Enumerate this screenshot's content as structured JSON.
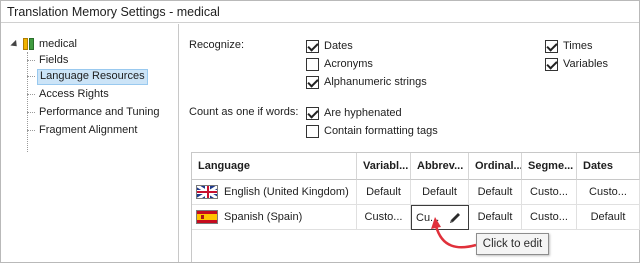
{
  "window": {
    "title": "Translation Memory Settings - medical"
  },
  "tree": {
    "root": "medical",
    "items": [
      {
        "label": "Fields",
        "selected": false
      },
      {
        "label": "Language Resources",
        "selected": true
      },
      {
        "label": "Access Rights",
        "selected": false
      },
      {
        "label": "Performance and Tuning",
        "selected": false
      },
      {
        "label": "Fragment Alignment",
        "selected": false
      }
    ]
  },
  "recognize": {
    "label": "Recognize:",
    "options": [
      {
        "label": "Dates",
        "checked": true
      },
      {
        "label": "Acronyms",
        "checked": false
      },
      {
        "label": "Alphanumeric strings",
        "checked": true
      },
      {
        "label": "Times",
        "checked": true
      },
      {
        "label": "Variables",
        "checked": true
      }
    ]
  },
  "count": {
    "label": "Count as one if words:",
    "options": [
      {
        "label": "Are hyphenated",
        "checked": true
      },
      {
        "label": "Contain formatting tags",
        "checked": false
      }
    ]
  },
  "grid": {
    "headers": [
      "Language",
      "Variabl...",
      "Abbrev...",
      "Ordinal...",
      "Segme...",
      "Dates"
    ],
    "rows": [
      {
        "language": "English (United Kingdom)",
        "flag": "uk-flag",
        "cells": [
          "Default",
          "Default",
          "Default",
          "Custo...",
          "Custo..."
        ]
      },
      {
        "language": "Spanish (Spain)",
        "flag": "spain-flag",
        "cells": [
          "Custo...",
          "Cu...",
          "Default",
          "Custo...",
          "Default"
        ]
      }
    ]
  },
  "tooltip": {
    "text": "Click to edit"
  },
  "colors": {
    "selection": "#cce4f7",
    "arrow": "#e0303a"
  }
}
